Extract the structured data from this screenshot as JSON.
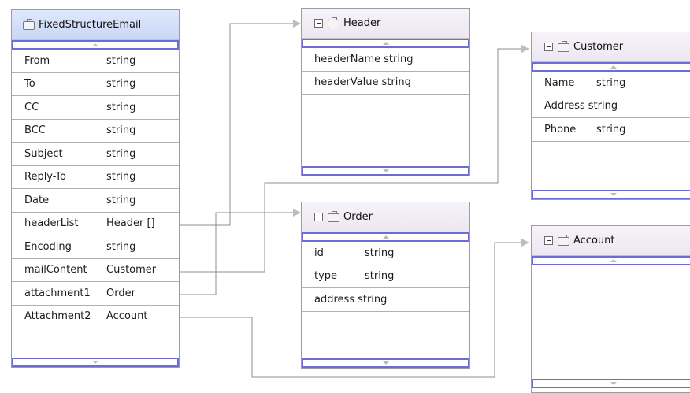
{
  "boxes": {
    "fixed": {
      "title": "FixedStructureEmail",
      "fields": [
        {
          "name": "From",
          "type": "string"
        },
        {
          "name": "To",
          "type": "string"
        },
        {
          "name": "CC",
          "type": "string"
        },
        {
          "name": "BCC",
          "type": "string"
        },
        {
          "name": "Subject",
          "type": "string"
        },
        {
          "name": "Reply-To",
          "type": "string"
        },
        {
          "name": "Date",
          "type": "string"
        },
        {
          "name": "headerList",
          "type": "Header []"
        },
        {
          "name": "Encoding",
          "type": "string"
        },
        {
          "name": "mailContent",
          "type": "Customer"
        },
        {
          "name": "attachment1",
          "type": "Order"
        },
        {
          "name": "Attachment2",
          "type": "Account"
        }
      ]
    },
    "header": {
      "title": "Header",
      "fields": [
        {
          "name": "headerName",
          "type": "string"
        },
        {
          "name": "headerValue",
          "type": "string"
        }
      ]
    },
    "order": {
      "title": "Order",
      "fields": [
        {
          "name": "id",
          "type": "string"
        },
        {
          "name": "type",
          "type": "string"
        },
        {
          "name": "address",
          "type": "string"
        }
      ]
    },
    "customer": {
      "title": "Customer",
      "fields": [
        {
          "name": "Name",
          "type": "string"
        },
        {
          "name": "Address",
          "type": "string"
        },
        {
          "name": "Phone",
          "type": "string"
        }
      ]
    },
    "account": {
      "title": "Account",
      "fields": []
    }
  },
  "colors": {
    "main_title_bg": "#d3dff8",
    "title_bg": "#efeaf3",
    "scroll_border": "#6c6cd4",
    "connector": "#8a8a8a"
  }
}
